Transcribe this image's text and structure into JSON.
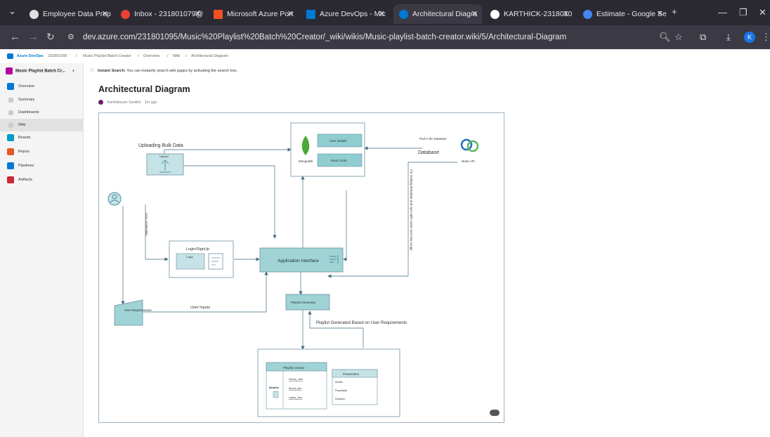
{
  "browser": {
    "tabs": [
      {
        "label": "Employee Data Prep",
        "color": "#e0e0e0"
      },
      {
        "label": "Inbox - 231801079@",
        "color": "#ea4335"
      },
      {
        "label": "Microsoft Azure Port",
        "color": "#f25022"
      },
      {
        "label": "Azure DevOps - Mic",
        "color": "#0078d4"
      },
      {
        "label": "Architectural Diagra",
        "color": "#0078d4"
      },
      {
        "label": "KARTHICK-2318010",
        "color": "#ffffff"
      },
      {
        "label": "Estimate - Google Se",
        "color": "#4285f4"
      }
    ],
    "new_tab": "+",
    "url": "dev.azure.com/231801095/Music%20Playlist%20Batch%20Creator/_wiki/wikis/Music-playlist-batch-creator.wiki/5/Architectural-Diagram",
    "profile_initial": "K"
  },
  "breadcrumb": {
    "app": "Azure DevOps",
    "org": "231801095",
    "project": "Music Playlist Batch Creator",
    "section": "Overview",
    "sub": "Wiki",
    "page": "Architectural Diagram"
  },
  "sidebar": {
    "project": "Music Playlist Batch Cr...",
    "items": [
      {
        "label": "Overview",
        "color": "#0078d4"
      },
      {
        "label": "Summary",
        "color": "#cccccc"
      },
      {
        "label": "Dashboards",
        "color": "#cccccc"
      },
      {
        "label": "Wiki",
        "color": "#cccccc"
      },
      {
        "label": "Boards",
        "color": "#009ccc"
      },
      {
        "label": "Repos",
        "color": "#e05a27"
      },
      {
        "label": "Pipelines",
        "color": "#0078d4"
      },
      {
        "label": "Artifacts",
        "color": "#cc2936"
      }
    ]
  },
  "main": {
    "instant_search_bold": "Instant Search:",
    "instant_search_text": "You can instantly search wiki pages by activating the search box.",
    "title": "Architectural Diagram",
    "author": "Karthikeyan Senthil",
    "time": "1m ago"
  },
  "diagram": {
    "uploading_bulk_data": "Uploading Bulk Data",
    "upload": "Upload",
    "mongodb": "MongoDB",
    "user_details": "User Details",
    "music_data": "Music Data",
    "find_in_database": "Find in the Database",
    "database": "Database",
    "music_api": "Music API",
    "vertical_api_text": "For Getting Metadata and sync with music and new songs",
    "user_credentials": "User credentials",
    "login_signup": "Login/SignUp",
    "login": "Login",
    "application_interface": "Application Interface",
    "user_requirements": "User Requirements",
    "user_inputs": "User Inputs",
    "playlist_generator": "Playlist Generator",
    "playlist_generated": "Playlist Generated Based on User Requirements",
    "playlist_creator": "Playlist Creator",
    "models": "Models",
    "genre_sim": "Genre_Sim",
    "mood_sim": "Mood_sim",
    "lyrics_sim": "Lyrics_Sim",
    "parameters": "Parameters",
    "artists": "Artists",
    "popularity": "Popularity",
    "random": "Random"
  }
}
